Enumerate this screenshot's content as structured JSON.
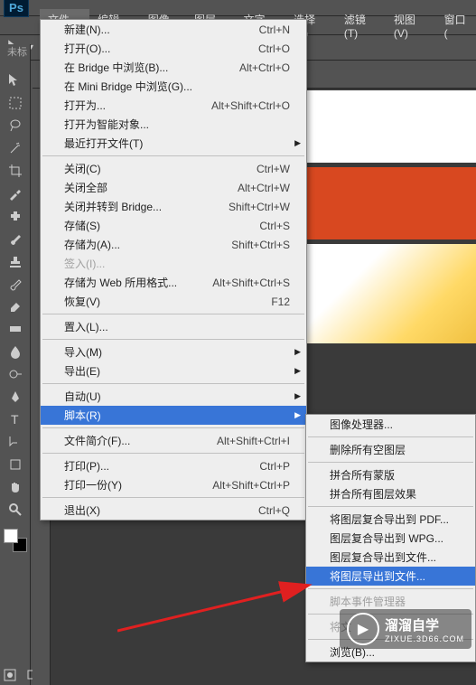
{
  "app": {
    "name": "Ps"
  },
  "menubar": {
    "items": [
      "文件(F)",
      "编辑(E)",
      "图像(I)",
      "图层(L)",
      "文字(Y)",
      "选择(S)",
      "滤镜(T)",
      "视图(V)",
      "窗口("
    ]
  },
  "tab": {
    "label": "未标"
  },
  "file_menu": {
    "groups": [
      [
        {
          "label": "新建(N)...",
          "shortcut": "Ctrl+N"
        },
        {
          "label": "打开(O)...",
          "shortcut": "Ctrl+O"
        },
        {
          "label": "在 Bridge 中浏览(B)...",
          "shortcut": "Alt+Ctrl+O"
        },
        {
          "label": "在 Mini Bridge 中浏览(G)...",
          "shortcut": ""
        },
        {
          "label": "打开为...",
          "shortcut": "Alt+Shift+Ctrl+O"
        },
        {
          "label": "打开为智能对象...",
          "shortcut": ""
        },
        {
          "label": "最近打开文件(T)",
          "shortcut": "",
          "submenu": true
        }
      ],
      [
        {
          "label": "关闭(C)",
          "shortcut": "Ctrl+W"
        },
        {
          "label": "关闭全部",
          "shortcut": "Alt+Ctrl+W"
        },
        {
          "label": "关闭并转到 Bridge...",
          "shortcut": "Shift+Ctrl+W"
        },
        {
          "label": "存储(S)",
          "shortcut": "Ctrl+S"
        },
        {
          "label": "存储为(A)...",
          "shortcut": "Shift+Ctrl+S"
        },
        {
          "label": "签入(I)...",
          "shortcut": "",
          "disabled": true
        },
        {
          "label": "存储为 Web 所用格式...",
          "shortcut": "Alt+Shift+Ctrl+S"
        },
        {
          "label": "恢复(V)",
          "shortcut": "F12"
        }
      ],
      [
        {
          "label": "置入(L)...",
          "shortcut": ""
        }
      ],
      [
        {
          "label": "导入(M)",
          "shortcut": "",
          "submenu": true
        },
        {
          "label": "导出(E)",
          "shortcut": "",
          "submenu": true
        }
      ],
      [
        {
          "label": "自动(U)",
          "shortcut": "",
          "submenu": true
        },
        {
          "label": "脚本(R)",
          "shortcut": "",
          "submenu": true,
          "highlighted": true
        }
      ],
      [
        {
          "label": "文件简介(F)...",
          "shortcut": "Alt+Shift+Ctrl+I"
        }
      ],
      [
        {
          "label": "打印(P)...",
          "shortcut": "Ctrl+P"
        },
        {
          "label": "打印一份(Y)",
          "shortcut": "Alt+Shift+Ctrl+P"
        }
      ],
      [
        {
          "label": "退出(X)",
          "shortcut": "Ctrl+Q"
        }
      ]
    ]
  },
  "script_submenu": {
    "groups": [
      [
        {
          "label": "图像处理器..."
        }
      ],
      [
        {
          "label": "删除所有空图层"
        }
      ],
      [
        {
          "label": "拼合所有蒙版"
        },
        {
          "label": "拼合所有图层效果"
        }
      ],
      [
        {
          "label": "将图层复合导出到 PDF..."
        },
        {
          "label": "图层复合导出到 WPG..."
        },
        {
          "label": "图层复合导出到文件..."
        },
        {
          "label": "将图层导出到文件...",
          "highlighted": true
        }
      ],
      [
        {
          "label": "脚本事件管理器",
          "disabled": true
        }
      ],
      [
        {
          "label": "将文",
          "disabled": true
        }
      ],
      [
        {
          "label": "浏览(B)..."
        }
      ]
    ]
  },
  "watermark": {
    "main": "溜溜自学",
    "sub": "ZIXUE.3D66.COM",
    "icon": "▶"
  }
}
